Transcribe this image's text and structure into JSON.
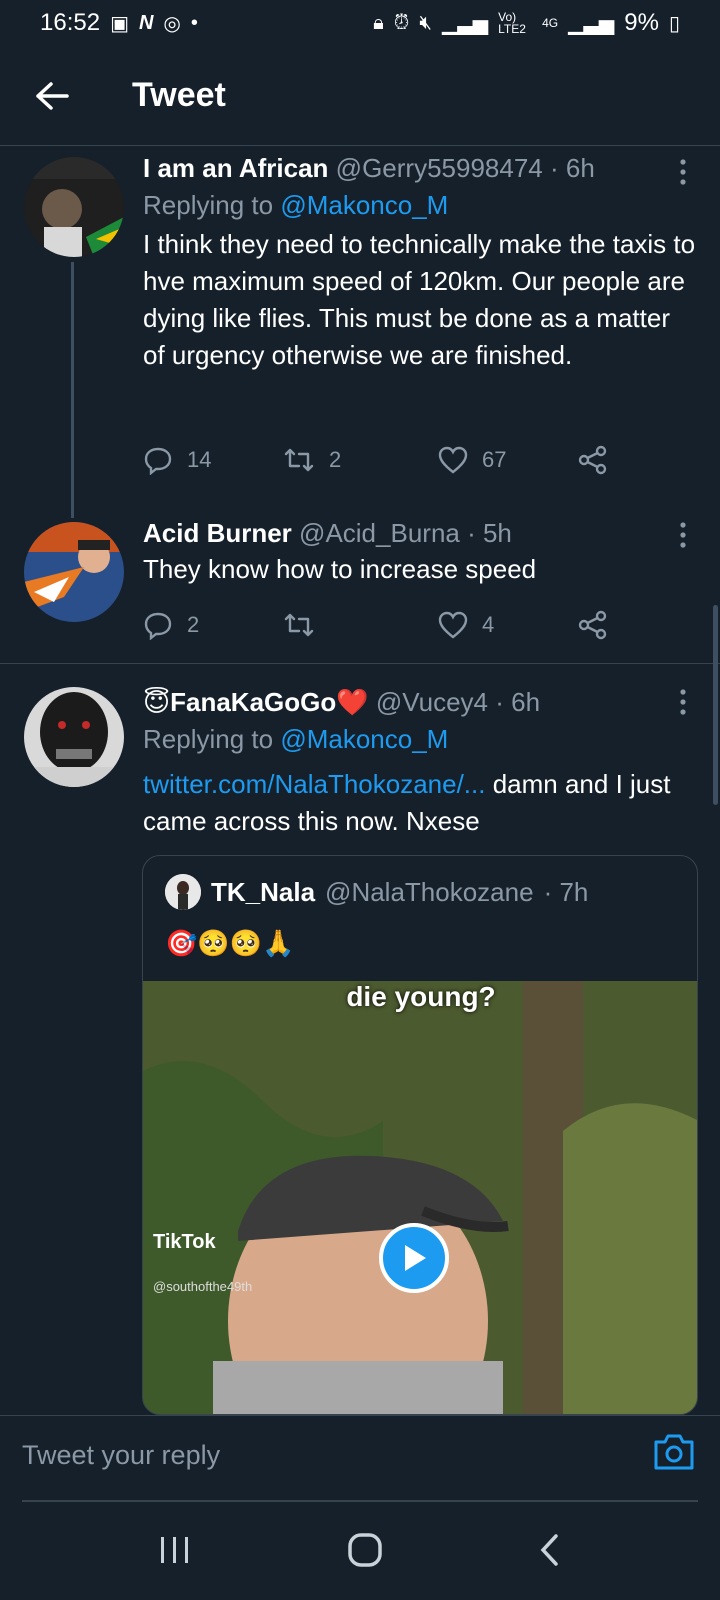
{
  "status_bar": {
    "time": "16:52",
    "left_icons": [
      "gallery-icon",
      "n-app-icon",
      "instagram-icon",
      "dot"
    ],
    "network": "Vo) LTE2",
    "network_type": "4G",
    "battery": "9%"
  },
  "header": {
    "title": "Tweet"
  },
  "tweets": [
    {
      "name": "I am an African",
      "handle": "@Gerry55998474",
      "time": "· 6h",
      "replying_prefix": "Replying to ",
      "replying_to": "@Makonco_M",
      "text": "I think they need to technically make the taxis to hve maximum speed of 120km. Our people are dying like flies. This must be done as a matter of urgency otherwise we are finished.",
      "replies": "14",
      "retweets": "2",
      "likes": "67"
    },
    {
      "name": "Acid Burner",
      "handle": "@Acid_Burna",
      "time": "· 5h",
      "text": "They know how to increase speed",
      "replies": "2",
      "retweets": "",
      "likes": "4"
    },
    {
      "name": "😇FanaKaGoGo❤️",
      "handle": "@Vucey4",
      "time": "· 6h",
      "replying_prefix": "Replying to ",
      "replying_to": "@Makonco_M",
      "link": "twitter.com/NalaThokozane/...",
      "text": " damn and I just came across this now. Nxese",
      "quote": {
        "name": "TK_Nala",
        "handle": "@NalaThokozane",
        "time": "· 7h",
        "emojis": "🎯🥺🥺🙏",
        "media_caption": "die young?",
        "tiktok_label": "TikTok",
        "tiktok_user": "@southofthe49th"
      }
    }
  ],
  "reply_bar": {
    "placeholder": "Tweet your reply"
  },
  "colors": {
    "background": "#15202b",
    "accent": "#1d9bf0",
    "muted": "#8b98a5",
    "divider": "#38444d"
  }
}
